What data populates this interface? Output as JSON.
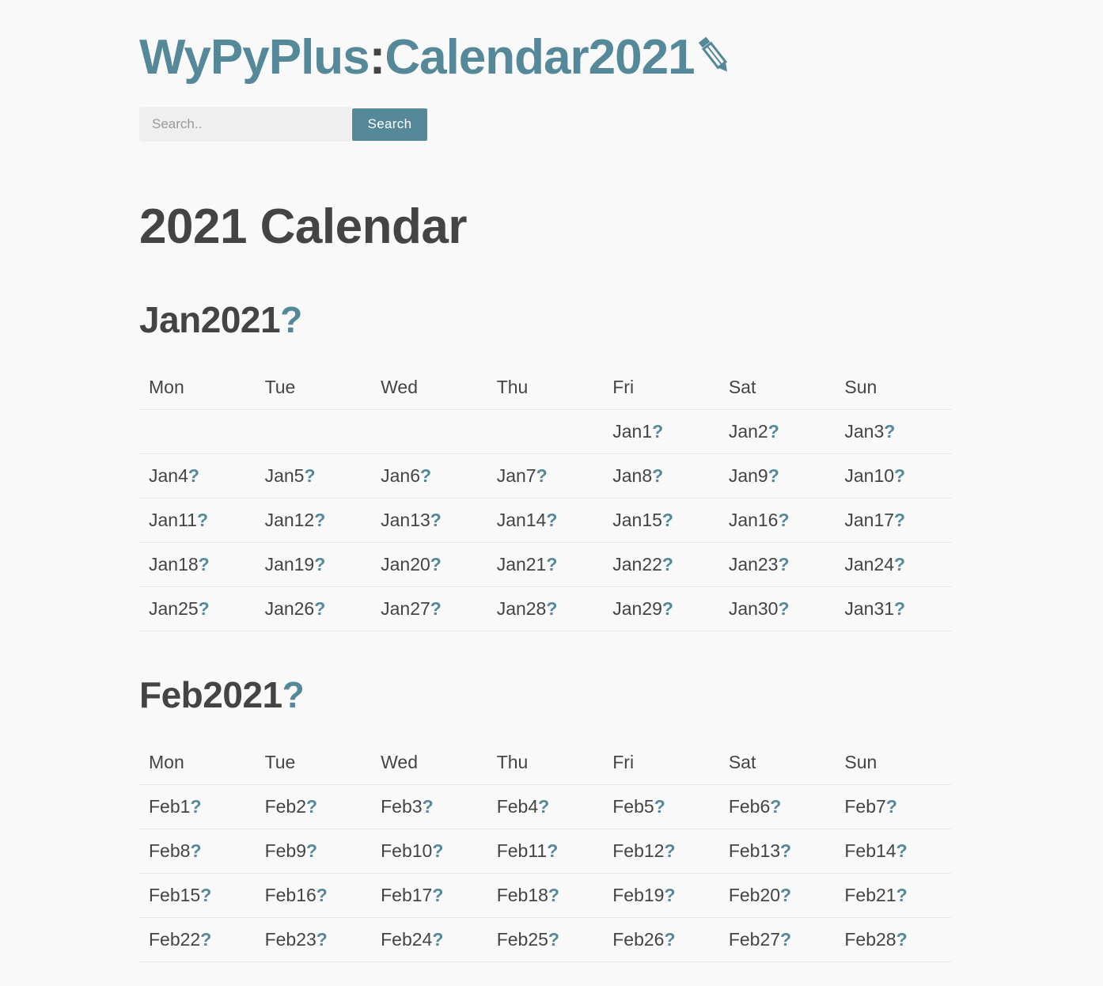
{
  "header": {
    "site_name": "WyPyPlus",
    "separator": ":",
    "page_name": "Calendar2021",
    "edit_icon": "pencil-icon"
  },
  "search": {
    "placeholder": "Search..",
    "value": "",
    "button_label": "Search"
  },
  "page_title": "2021 Calendar",
  "months": [
    {
      "title": "Jan2021",
      "missing_marker": "?",
      "weekdays": [
        "Mon",
        "Tue",
        "Wed",
        "Thu",
        "Fri",
        "Sat",
        "Sun"
      ],
      "weeks": [
        [
          "",
          "",
          "",
          "",
          "Jan1",
          "Jan2",
          "Jan3"
        ],
        [
          "Jan4",
          "Jan5",
          "Jan6",
          "Jan7",
          "Jan8",
          "Jan9",
          "Jan10"
        ],
        [
          "Jan11",
          "Jan12",
          "Jan13",
          "Jan14",
          "Jan15",
          "Jan16",
          "Jan17"
        ],
        [
          "Jan18",
          "Jan19",
          "Jan20",
          "Jan21",
          "Jan22",
          "Jan23",
          "Jan24"
        ],
        [
          "Jan25",
          "Jan26",
          "Jan27",
          "Jan28",
          "Jan29",
          "Jan30",
          "Jan31"
        ]
      ]
    },
    {
      "title": "Feb2021",
      "missing_marker": "?",
      "weekdays": [
        "Mon",
        "Tue",
        "Wed",
        "Thu",
        "Fri",
        "Sat",
        "Sun"
      ],
      "weeks": [
        [
          "Feb1",
          "Feb2",
          "Feb3",
          "Feb4",
          "Feb5",
          "Feb6",
          "Feb7"
        ],
        [
          "Feb8",
          "Feb9",
          "Feb10",
          "Feb11",
          "Feb12",
          "Feb13",
          "Feb14"
        ],
        [
          "Feb15",
          "Feb16",
          "Feb17",
          "Feb18",
          "Feb19",
          "Feb20",
          "Feb21"
        ],
        [
          "Feb22",
          "Feb23",
          "Feb24",
          "Feb25",
          "Feb26",
          "Feb27",
          "Feb28"
        ]
      ]
    }
  ],
  "colors": {
    "accent": "#558899",
    "text": "#444444",
    "background": "#f9f9f9",
    "input_background": "#efefef",
    "row_border": "#e6e6e6"
  }
}
